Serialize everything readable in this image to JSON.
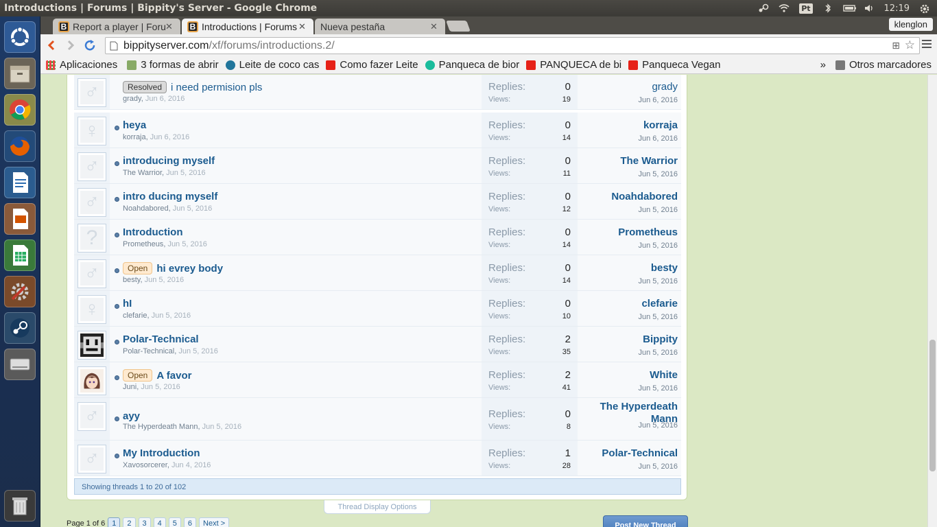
{
  "panel": {
    "window_title": "Introductions | Forums | Bippity's Server - Google Chrome",
    "keyboard_layout": "Pt",
    "clock": "12:19"
  },
  "browser": {
    "tabs": [
      {
        "label": "Report a player | Forums",
        "active": false
      },
      {
        "label": "Introductions | Forums",
        "active": true
      },
      {
        "label": "Nueva pestaña",
        "active": false
      }
    ],
    "profile_name": "klenglon",
    "url_host": "bippityserver.com",
    "url_path": "/xf/forums/introductions.2/",
    "bookmarks": [
      {
        "label": "Aplicaciones",
        "icon": "apps-grid-icon",
        "color": "#e44"
      },
      {
        "label": "3 formas de abrir",
        "icon": "bookmark-site-icon",
        "color": "#8a6"
      },
      {
        "label": "Leite de coco cas",
        "icon": "wordpress-icon",
        "color": "#21759b"
      },
      {
        "label": "Como fazer Leite",
        "icon": "youtube-icon",
        "color": "#e62117"
      },
      {
        "label": "Panqueca de bior",
        "icon": "bookmark-site-icon",
        "color": "#1abc9c"
      },
      {
        "label": "PANQUECA de bi",
        "icon": "youtube-icon",
        "color": "#e62117"
      },
      {
        "label": "Panqueca Vegan",
        "icon": "youtube-icon",
        "color": "#e62117"
      }
    ],
    "more_bookmarks": "»",
    "other_bookmarks": "Otros marcadores"
  },
  "forum": {
    "replies_label": "Replies:",
    "views_label": "Views:",
    "threads": [
      {
        "prefix": "Resolved",
        "title": "i need permision pls",
        "author": "grady",
        "date": "Jun 6, 2016",
        "replies": "0",
        "views": "19",
        "last_user": "grady",
        "last_date": "Jun 6, 2016",
        "avatar": "male",
        "bold": false
      },
      {
        "prefix": "",
        "title": "heya",
        "author": "korraja",
        "date": "Jun 6, 2016",
        "replies": "0",
        "views": "14",
        "last_user": "korraja",
        "last_date": "Jun 6, 2016",
        "avatar": "female",
        "bold": true
      },
      {
        "prefix": "",
        "title": "introducing myself",
        "author": "The Warrior",
        "date": "Jun 5, 2016",
        "replies": "0",
        "views": "11",
        "last_user": "The Warrior",
        "last_date": "Jun 5, 2016",
        "avatar": "male",
        "bold": true
      },
      {
        "prefix": "",
        "title": "intro ducing myself",
        "author": "Noahdabored",
        "date": "Jun 5, 2016",
        "replies": "0",
        "views": "12",
        "last_user": "Noahdabored",
        "last_date": "Jun 5, 2016",
        "avatar": "male",
        "bold": true
      },
      {
        "prefix": "",
        "title": "Introduction",
        "author": "Prometheus",
        "date": "Jun 5, 2016",
        "replies": "0",
        "views": "14",
        "last_user": "Prometheus",
        "last_date": "Jun 5, 2016",
        "avatar": "unknown",
        "bold": true
      },
      {
        "prefix": "Open",
        "title": "hi evrey body",
        "author": "besty",
        "date": "Jun 5, 2016",
        "replies": "0",
        "views": "14",
        "last_user": "besty",
        "last_date": "Jun 5, 2016",
        "avatar": "male",
        "bold": true
      },
      {
        "prefix": "",
        "title": "hI",
        "author": "clefarie",
        "date": "Jun 5, 2016",
        "replies": "0",
        "views": "10",
        "last_user": "clefarie",
        "last_date": "Jun 5, 2016",
        "avatar": "female",
        "bold": true
      },
      {
        "prefix": "",
        "title": "Polar-Technical",
        "author": "Polar-Technical",
        "date": "Jun 5, 2016",
        "replies": "2",
        "views": "35",
        "last_user": "Bippity",
        "last_date": "Jun 5, 2016",
        "avatar": "pixel",
        "bold": true
      },
      {
        "prefix": "Open",
        "title": "A favor",
        "author": "Juni",
        "date": "Jun 5, 2016",
        "replies": "2",
        "views": "41",
        "last_user": "White",
        "last_date": "Jun 5, 2016",
        "avatar": "anime",
        "bold": true
      },
      {
        "prefix": "",
        "title": "ayy",
        "author": "The Hyperdeath Mann",
        "date": "Jun 5, 2016",
        "replies": "0",
        "views": "8",
        "last_user": "The Hyperdeath Mann",
        "last_date": "Jun 5, 2016",
        "avatar": "male",
        "bold": true
      },
      {
        "prefix": "",
        "title": "My Introduction",
        "author": "Xavosorcerer",
        "date": "Jun 4, 2016",
        "replies": "1",
        "views": "28",
        "last_user": "Polar-Technical",
        "last_date": "Jun 5, 2016",
        "avatar": "male",
        "bold": true
      }
    ],
    "showing_text": "Showing threads 1 to 20 of 102",
    "display_options": "Thread Display Options",
    "page_label": "Page 1 of 6",
    "pages": [
      "1",
      "2",
      "3",
      "4",
      "5",
      "6"
    ],
    "next_label": "Next >",
    "post_button": "Post New Thread"
  }
}
